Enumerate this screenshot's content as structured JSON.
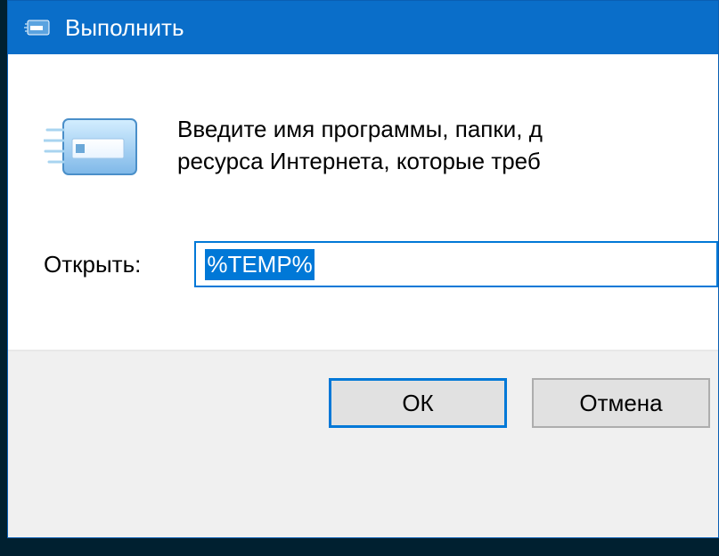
{
  "titlebar": {
    "title": "Выполнить"
  },
  "content": {
    "description": "Введите имя программы, папки, д\nресурса Интернета, которые треб",
    "open_label": "Открыть:",
    "open_value": "%TEMP%"
  },
  "buttons": {
    "ok": "ОК",
    "cancel": "Отмена"
  }
}
